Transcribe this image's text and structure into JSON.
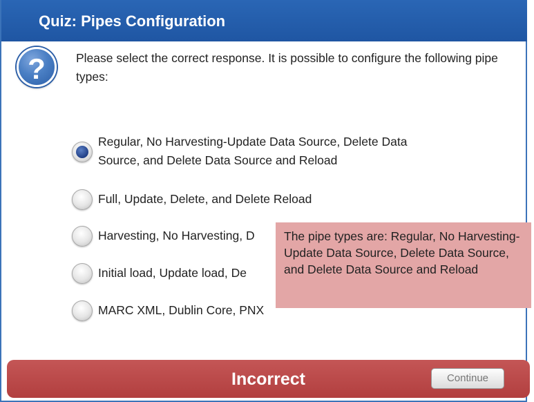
{
  "header": {
    "title": "Quiz: Pipes Configuration"
  },
  "question": {
    "icon": "question-mark-icon",
    "text": "Please select the correct response.  It is possible to configure the following pipe types:"
  },
  "options": [
    {
      "line1": "Regular, No Harvesting-Update Data Source, Delete Data",
      "line2": "Source, and Delete Data Source and Reload",
      "selected": true
    },
    {
      "line1": "Full, Update, Delete, and Delete Reload",
      "line2": "",
      "selected": false
    },
    {
      "line1": "Harvesting, No Harvesting, D",
      "line2": "",
      "selected": false
    },
    {
      "line1": "Initial load, Update load, De",
      "line2": "",
      "selected": false
    },
    {
      "line1": "MARC XML, Dublin Core, PNX",
      "line2": "",
      "selected": false
    }
  ],
  "feedback": {
    "text": "The pipe types are: Regular, No Harvesting-Update Data Source, Delete Data Source, and Delete Data Source and Reload"
  },
  "footer": {
    "status": "Incorrect",
    "continue_label": "Continue"
  },
  "colors": {
    "header_blue": "#2a66b5",
    "feedback_bg": "#e3a6a6",
    "footer_red": "#b23f3f"
  }
}
